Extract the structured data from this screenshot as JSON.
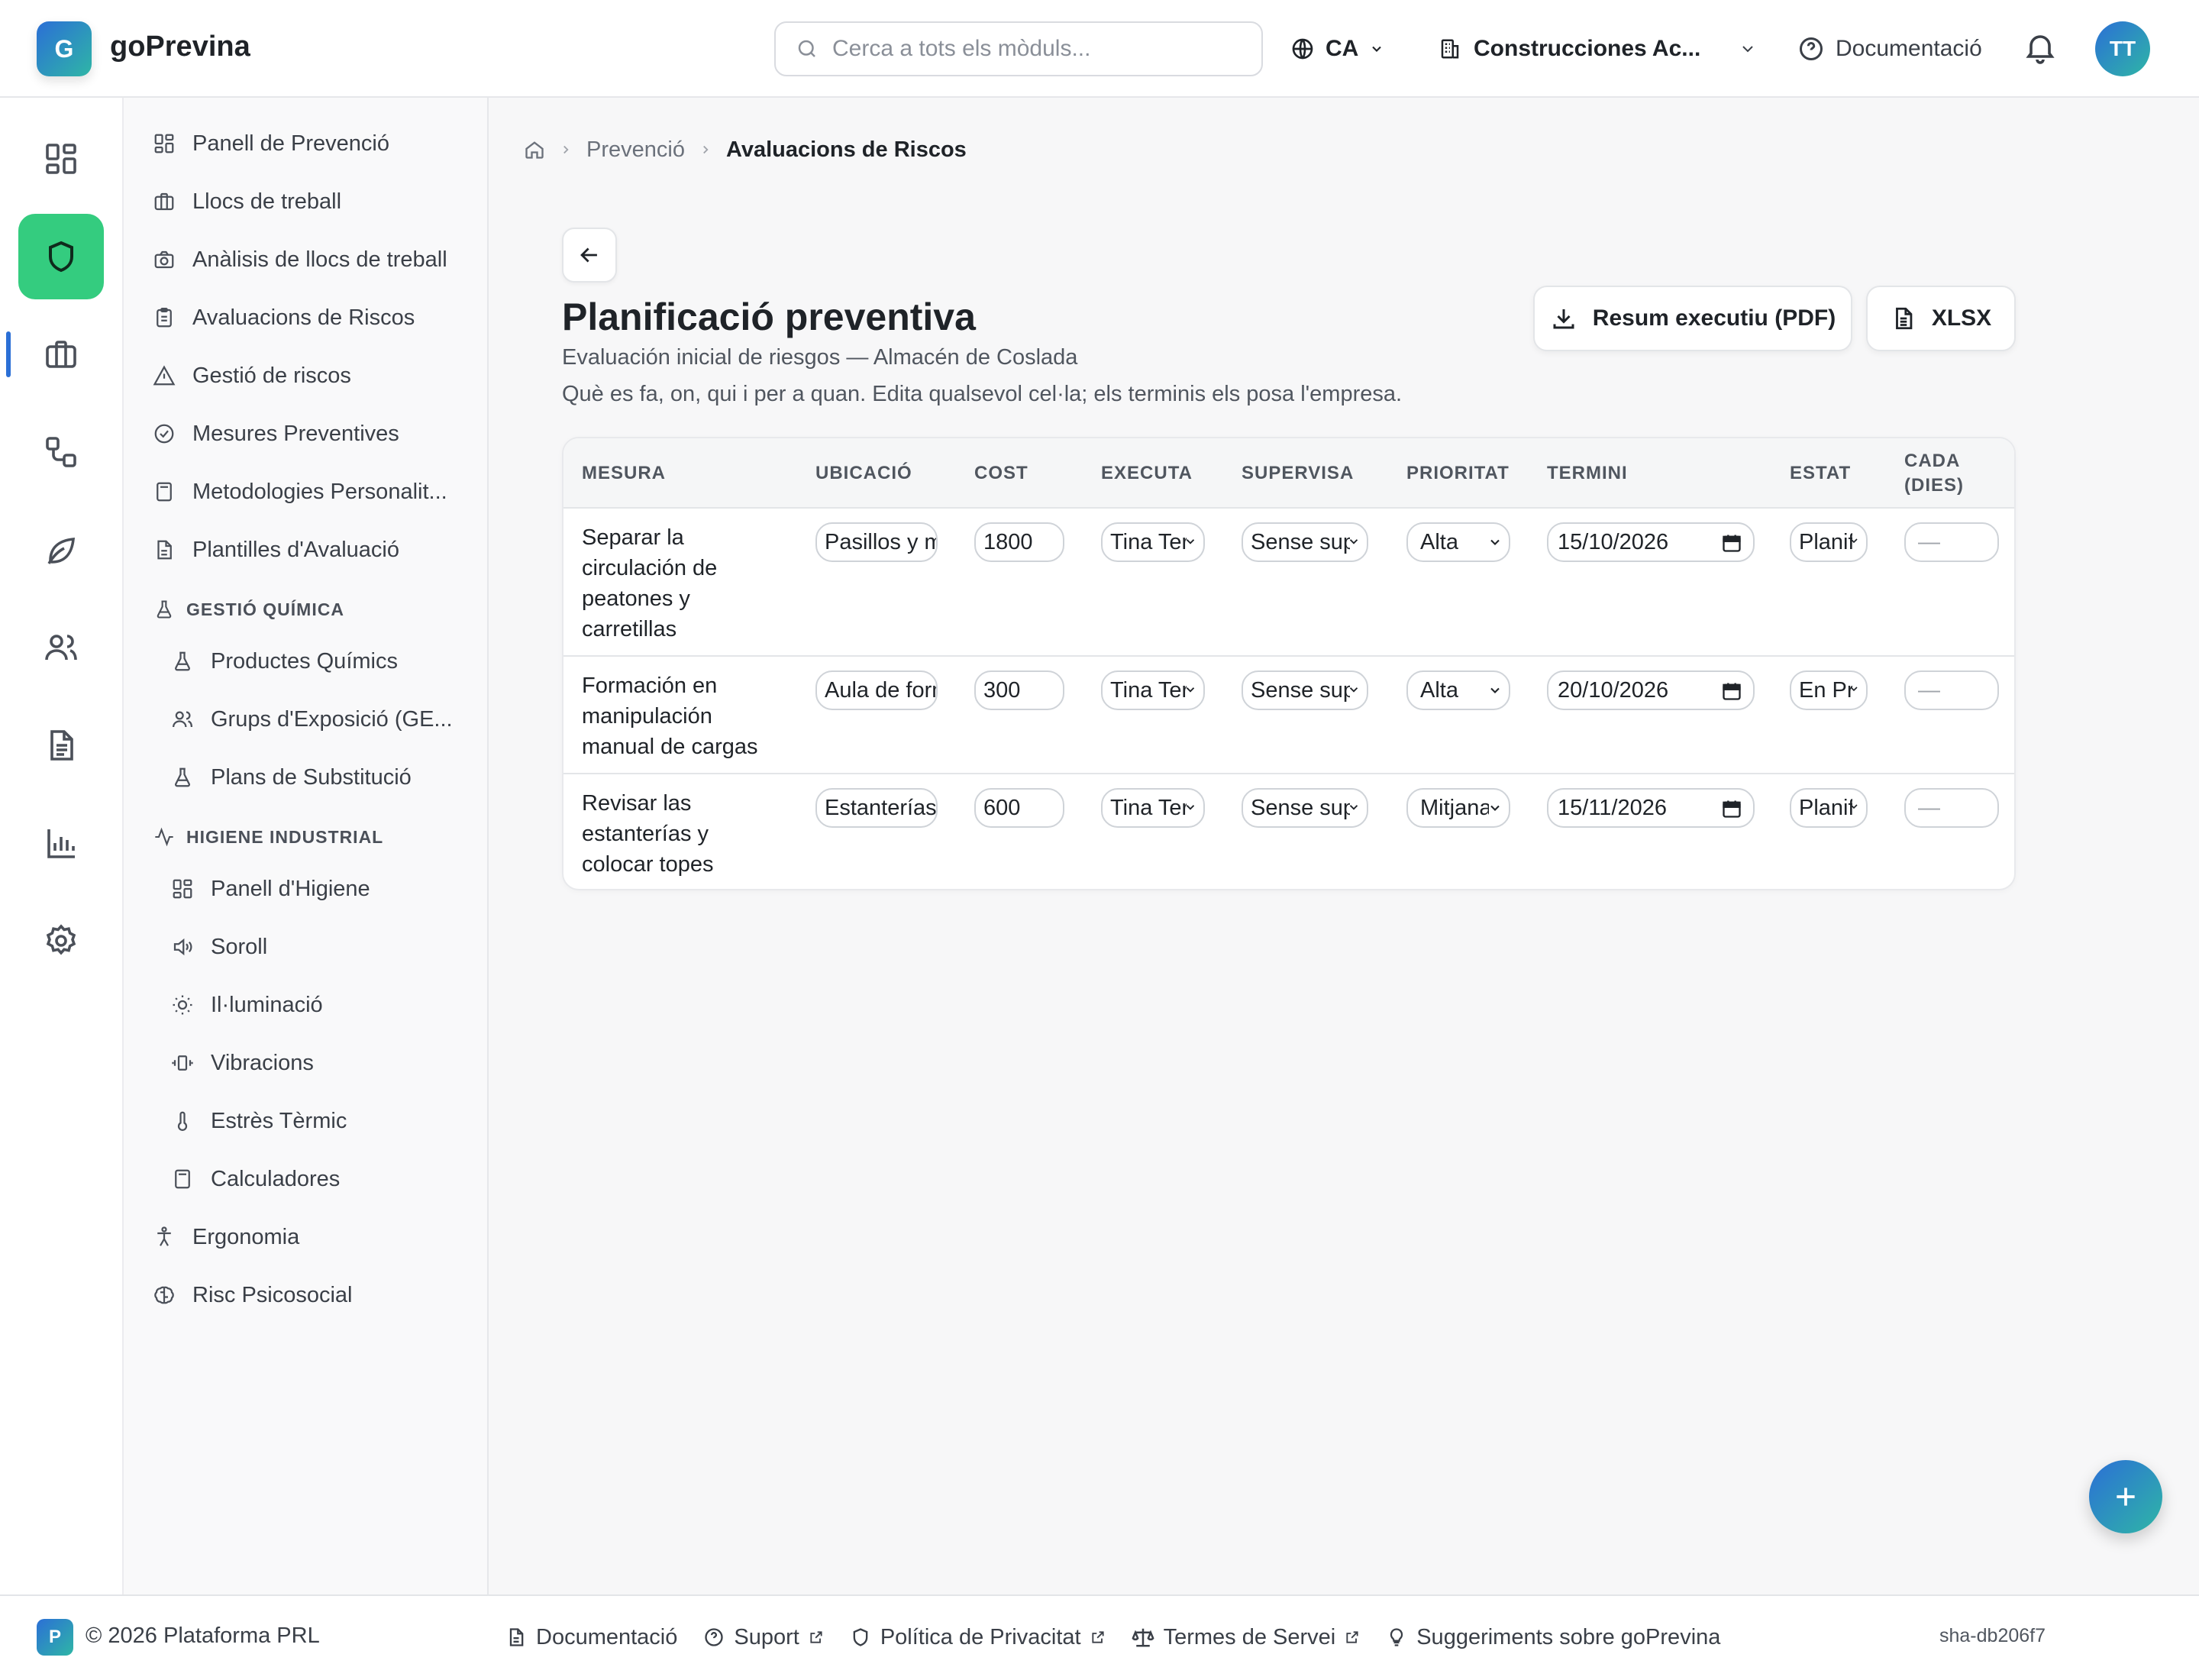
{
  "app": {
    "name": "goPrevina",
    "logo_letter": "G"
  },
  "header": {
    "search_placeholder": "Cerca a tots els mòduls...",
    "language": "CA",
    "company": "Construcciones Ac...",
    "docs_label": "Documentació",
    "user_initials": "TT"
  },
  "sidebar": {
    "items": [
      {
        "label": "Panell de Prevenció",
        "icon": "dashboard-icon"
      },
      {
        "label": "Llocs de treball",
        "icon": "building-icon"
      },
      {
        "label": "Anàlisis de llocs de treball",
        "icon": "camera-icon"
      },
      {
        "label": "Avaluacions de Riscos",
        "icon": "clipboard-icon"
      },
      {
        "label": "Gestió de riscos",
        "icon": "warning-icon"
      },
      {
        "label": "Mesures Preventives",
        "icon": "check-circle-icon"
      },
      {
        "label": "Metodologies Personalit...",
        "icon": "calculator-icon"
      },
      {
        "label": "Plantilles d'Avaluació",
        "icon": "document-icon"
      }
    ],
    "chem_section": "GESTIÓ QUÍMICA",
    "chem_items": [
      {
        "label": "Productes Químics",
        "icon": "flask-icon"
      },
      {
        "label": "Grups d'Exposició (GE...",
        "icon": "users-icon"
      },
      {
        "label": "Plans de Substitució",
        "icon": "flask-icon"
      }
    ],
    "hygiene_section": "HIGIENE INDUSTRIAL",
    "hygiene_items": [
      {
        "label": "Panell d'Higiene",
        "icon": "dashboard-icon"
      },
      {
        "label": "Soroll",
        "icon": "speaker-icon"
      },
      {
        "label": "Il·luminació",
        "icon": "sun-icon"
      },
      {
        "label": "Vibracions",
        "icon": "vibration-icon"
      },
      {
        "label": "Estrès Tèrmic",
        "icon": "thermometer-icon"
      },
      {
        "label": "Calculadores",
        "icon": "calculator-icon"
      }
    ],
    "tail_items": [
      {
        "label": "Ergonomia",
        "icon": "person-icon"
      },
      {
        "label": "Risc Psicosocial",
        "icon": "brain-icon"
      }
    ]
  },
  "breadcrumb": {
    "parent": "Prevenció",
    "current": "Avaluacions de Riscos"
  },
  "page": {
    "title": "Planificació preventiva",
    "subtitle": "Evaluación inicial de riesgos — Almacén de Coslada",
    "description": "Què es fa, on, qui i per a quan. Edita qualsevol cel·la; els terminis els posa l'empresa.",
    "pdf_button": "Resum executiu (PDF)",
    "xlsx_button": "XLSX"
  },
  "table": {
    "headers": {
      "measure": "MESURA",
      "location": "UBICACIÓ",
      "cost": "COST",
      "executes": "EXECUTA",
      "supervises": "SUPERVISA",
      "priority": "PRIORITAT",
      "deadline": "TERMINI",
      "status": "ESTAT",
      "every_a": "CADA",
      "every_b": "(DIES)"
    },
    "empty_value": "—",
    "rows": [
      {
        "measure": "Separar la circulación de peatones y carretillas",
        "location": "Pasillos y muelles",
        "cost": "1800",
        "executes": "Tina Ter",
        "supervises": "Sense supervisor",
        "priority": "Alta",
        "deadline": "15/10/2026",
        "status": "Planificada"
      },
      {
        "measure": "Formación en manipulación manual de cargas",
        "location": "Aula de formación",
        "cost": "300",
        "executes": "Tina Ter",
        "supervises": "Sense supervisor",
        "priority": "Alta",
        "deadline": "20/10/2026",
        "status": "En Procés"
      },
      {
        "measure": "Revisar las estanterías y colocar topes",
        "location": "Estanterías",
        "cost": "600",
        "executes": "Tina Ter",
        "supervises": "Sense supervisor",
        "priority": "Mitjana",
        "deadline": "15/11/2026",
        "status": "Planificada"
      }
    ]
  },
  "footer": {
    "badge": "P",
    "copyright": "© 2026 Plataforma PRL",
    "links": {
      "docs": "Documentació",
      "support": "Suport",
      "privacy": "Política de Privacitat",
      "terms": "Termes de Servei",
      "suggestions": "Suggeriments sobre goPrevina"
    },
    "version": "sha-db206f7"
  },
  "colors": {
    "accent_green": "#34cc7f",
    "brand_gradient_start": "#2b6fd6",
    "brand_gradient_end": "#2fb6a6"
  }
}
